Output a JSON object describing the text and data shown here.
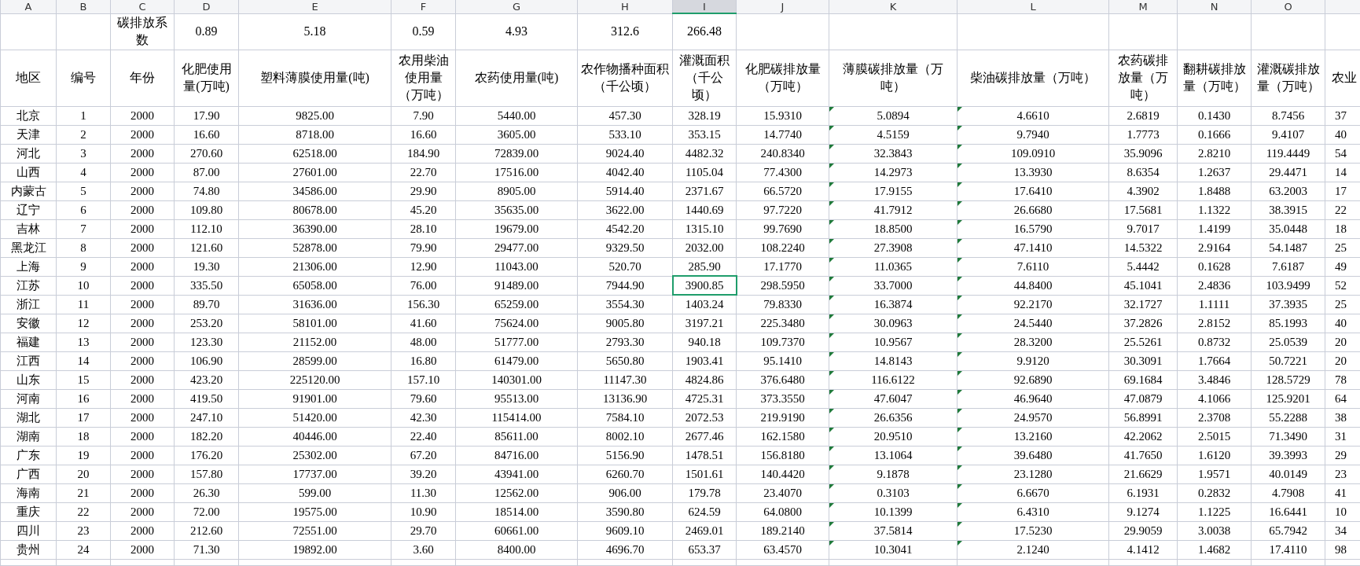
{
  "columns": [
    {
      "letter": "A",
      "selected": false,
      "header": "地区",
      "flagged": false
    },
    {
      "letter": "B",
      "selected": false,
      "header": "编号",
      "flagged": false
    },
    {
      "letter": "C",
      "selected": false,
      "coefficient": "碳排放系数",
      "header": "年份",
      "flagged": false
    },
    {
      "letter": "D",
      "selected": false,
      "coefficient": "0.89",
      "header": "化肥使用量(万吨)",
      "flagged": false
    },
    {
      "letter": "E",
      "selected": false,
      "coefficient": "5.18",
      "header": "塑料薄膜使用量(吨)",
      "flagged": false
    },
    {
      "letter": "F",
      "selected": false,
      "coefficient": "0.59",
      "header": "农用柴油使用量（万吨）",
      "flagged": false
    },
    {
      "letter": "G",
      "selected": false,
      "coefficient": "4.93",
      "header": "农药使用量(吨)",
      "flagged": false
    },
    {
      "letter": "H",
      "selected": false,
      "coefficient": "312.6",
      "header": "农作物播种面积（千公顷）",
      "flagged": false
    },
    {
      "letter": "I",
      "selected": true,
      "coefficient": "266.48",
      "header": "灌溉面积（千公顷）",
      "flagged": false
    },
    {
      "letter": "J",
      "selected": false,
      "header": "化肥碳排放量（万吨）",
      "flagged": false
    },
    {
      "letter": "K",
      "selected": false,
      "header": "薄膜碳排放量（万吨）",
      "flagged": true
    },
    {
      "letter": "L",
      "selected": false,
      "header": "柴油碳排放量（万吨）",
      "flagged": true
    },
    {
      "letter": "M",
      "selected": false,
      "header": "农药碳排放量（万吨）",
      "flagged": false
    },
    {
      "letter": "N",
      "selected": false,
      "header": "翻耕碳排放量（万吨）",
      "flagged": false
    },
    {
      "letter": "O",
      "selected": false,
      "header": "灌溉碳排放量（万吨）",
      "flagged": false
    },
    {
      "selected": false,
      "header": "农业",
      "flagged": false
    }
  ],
  "rows": [
    {
      "selected": false,
      "cells": [
        "北京",
        "1",
        "2000",
        "17.90",
        "9825.00",
        "7.90",
        "5440.00",
        "457.30",
        "328.19",
        "15.9310",
        "5.0894",
        "4.6610",
        "2.6819",
        "0.1430",
        "8.7456",
        "37"
      ]
    },
    {
      "selected": false,
      "cells": [
        "天津",
        "2",
        "2000",
        "16.60",
        "8718.00",
        "16.60",
        "3605.00",
        "533.10",
        "353.15",
        "14.7740",
        "4.5159",
        "9.7940",
        "1.7773",
        "0.1666",
        "9.4107",
        "40"
      ]
    },
    {
      "selected": false,
      "cells": [
        "河北",
        "3",
        "2000",
        "270.60",
        "62518.00",
        "184.90",
        "72839.00",
        "9024.40",
        "4482.32",
        "240.8340",
        "32.3843",
        "109.0910",
        "35.9096",
        "2.8210",
        "119.4449",
        "54"
      ]
    },
    {
      "selected": false,
      "cells": [
        "山西",
        "4",
        "2000",
        "87.00",
        "27601.00",
        "22.70",
        "17516.00",
        "4042.40",
        "1105.04",
        "77.4300",
        "14.2973",
        "13.3930",
        "8.6354",
        "1.2637",
        "29.4471",
        "14"
      ]
    },
    {
      "selected": false,
      "cells": [
        "内蒙古",
        "5",
        "2000",
        "74.80",
        "34586.00",
        "29.90",
        "8905.00",
        "5914.40",
        "2371.67",
        "66.5720",
        "17.9155",
        "17.6410",
        "4.3902",
        "1.8488",
        "63.2003",
        "17"
      ]
    },
    {
      "selected": false,
      "cells": [
        "辽宁",
        "6",
        "2000",
        "109.80",
        "80678.00",
        "45.20",
        "35635.00",
        "3622.00",
        "1440.69",
        "97.7220",
        "41.7912",
        "26.6680",
        "17.5681",
        "1.1322",
        "38.3915",
        "22"
      ]
    },
    {
      "selected": false,
      "cells": [
        "吉林",
        "7",
        "2000",
        "112.10",
        "36390.00",
        "28.10",
        "19679.00",
        "4542.20",
        "1315.10",
        "99.7690",
        "18.8500",
        "16.5790",
        "9.7017",
        "1.4199",
        "35.0448",
        "18"
      ]
    },
    {
      "selected": false,
      "cells": [
        "黑龙江",
        "8",
        "2000",
        "121.60",
        "52878.00",
        "79.90",
        "29477.00",
        "9329.50",
        "2032.00",
        "108.2240",
        "27.3908",
        "47.1410",
        "14.5322",
        "2.9164",
        "54.1487",
        "25"
      ]
    },
    {
      "selected": false,
      "cells": [
        "上海",
        "9",
        "2000",
        "19.30",
        "21306.00",
        "12.90",
        "11043.00",
        "520.70",
        "285.90",
        "17.1770",
        "11.0365",
        "7.6110",
        "5.4442",
        "0.1628",
        "7.6187",
        "49"
      ]
    },
    {
      "selected": true,
      "cells": [
        "江苏",
        "10",
        "2000",
        "335.50",
        "65058.00",
        "76.00",
        "91489.00",
        "7944.90",
        "3900.85",
        "298.5950",
        "33.7000",
        "44.8400",
        "45.1041",
        "2.4836",
        "103.9499",
        "52"
      ]
    },
    {
      "selected": false,
      "cells": [
        "浙江",
        "11",
        "2000",
        "89.70",
        "31636.00",
        "156.30",
        "65259.00",
        "3554.30",
        "1403.24",
        "79.8330",
        "16.3874",
        "92.2170",
        "32.1727",
        "1.1111",
        "37.3935",
        "25"
      ]
    },
    {
      "selected": false,
      "cells": [
        "安徽",
        "12",
        "2000",
        "253.20",
        "58101.00",
        "41.60",
        "75624.00",
        "9005.80",
        "3197.21",
        "225.3480",
        "30.0963",
        "24.5440",
        "37.2826",
        "2.8152",
        "85.1993",
        "40"
      ]
    },
    {
      "selected": false,
      "cells": [
        "福建",
        "13",
        "2000",
        "123.30",
        "21152.00",
        "48.00",
        "51777.00",
        "2793.30",
        "940.18",
        "109.7370",
        "10.9567",
        "28.3200",
        "25.5261",
        "0.8732",
        "25.0539",
        "20"
      ]
    },
    {
      "selected": false,
      "cells": [
        "江西",
        "14",
        "2000",
        "106.90",
        "28599.00",
        "16.80",
        "61479.00",
        "5650.80",
        "1903.41",
        "95.1410",
        "14.8143",
        "9.9120",
        "30.3091",
        "1.7664",
        "50.7221",
        "20"
      ]
    },
    {
      "selected": false,
      "cells": [
        "山东",
        "15",
        "2000",
        "423.20",
        "225120.00",
        "157.10",
        "140301.00",
        "11147.30",
        "4824.86",
        "376.6480",
        "116.6122",
        "92.6890",
        "69.1684",
        "3.4846",
        "128.5729",
        "78"
      ]
    },
    {
      "selected": false,
      "cells": [
        "河南",
        "16",
        "2000",
        "419.50",
        "91901.00",
        "79.60",
        "95513.00",
        "13136.90",
        "4725.31",
        "373.3550",
        "47.6047",
        "46.9640",
        "47.0879",
        "4.1066",
        "125.9201",
        "64"
      ]
    },
    {
      "selected": false,
      "cells": [
        "湖北",
        "17",
        "2000",
        "247.10",
        "51420.00",
        "42.30",
        "115414.00",
        "7584.10",
        "2072.53",
        "219.9190",
        "26.6356",
        "24.9570",
        "56.8991",
        "2.3708",
        "55.2288",
        "38"
      ]
    },
    {
      "selected": false,
      "cells": [
        "湖南",
        "18",
        "2000",
        "182.20",
        "40446.00",
        "22.40",
        "85611.00",
        "8002.10",
        "2677.46",
        "162.1580",
        "20.9510",
        "13.2160",
        "42.2062",
        "2.5015",
        "71.3490",
        "31"
      ]
    },
    {
      "selected": false,
      "cells": [
        "广东",
        "19",
        "2000",
        "176.20",
        "25302.00",
        "67.20",
        "84716.00",
        "5156.90",
        "1478.51",
        "156.8180",
        "13.1064",
        "39.6480",
        "41.7650",
        "1.6120",
        "39.3993",
        "29"
      ]
    },
    {
      "selected": false,
      "cells": [
        "广西",
        "20",
        "2000",
        "157.80",
        "17737.00",
        "39.20",
        "43941.00",
        "6260.70",
        "1501.61",
        "140.4420",
        "9.1878",
        "23.1280",
        "21.6629",
        "1.9571",
        "40.0149",
        "23"
      ]
    },
    {
      "selected": false,
      "cells": [
        "海南",
        "21",
        "2000",
        "26.30",
        "599.00",
        "11.30",
        "12562.00",
        "906.00",
        "179.78",
        "23.4070",
        "0.3103",
        "6.6670",
        "6.1931",
        "0.2832",
        "4.7908",
        "41"
      ]
    },
    {
      "selected": false,
      "cells": [
        "重庆",
        "22",
        "2000",
        "72.00",
        "19575.00",
        "10.90",
        "18514.00",
        "3590.80",
        "624.59",
        "64.0800",
        "10.1399",
        "6.4310",
        "9.1274",
        "1.1225",
        "16.6441",
        "10"
      ]
    },
    {
      "selected": false,
      "cells": [
        "四川",
        "23",
        "2000",
        "212.60",
        "72551.00",
        "29.70",
        "60661.00",
        "9609.10",
        "2469.01",
        "189.2140",
        "37.5814",
        "17.5230",
        "29.9059",
        "3.0038",
        "65.7942",
        "34"
      ]
    },
    {
      "selected": false,
      "cells": [
        "贵州",
        "24",
        "2000",
        "71.30",
        "19892.00",
        "3.60",
        "8400.00",
        "4696.70",
        "653.37",
        "63.4570",
        "10.3041",
        "2.1240",
        "4.1412",
        "1.4682",
        "17.4110",
        "98"
      ]
    }
  ]
}
